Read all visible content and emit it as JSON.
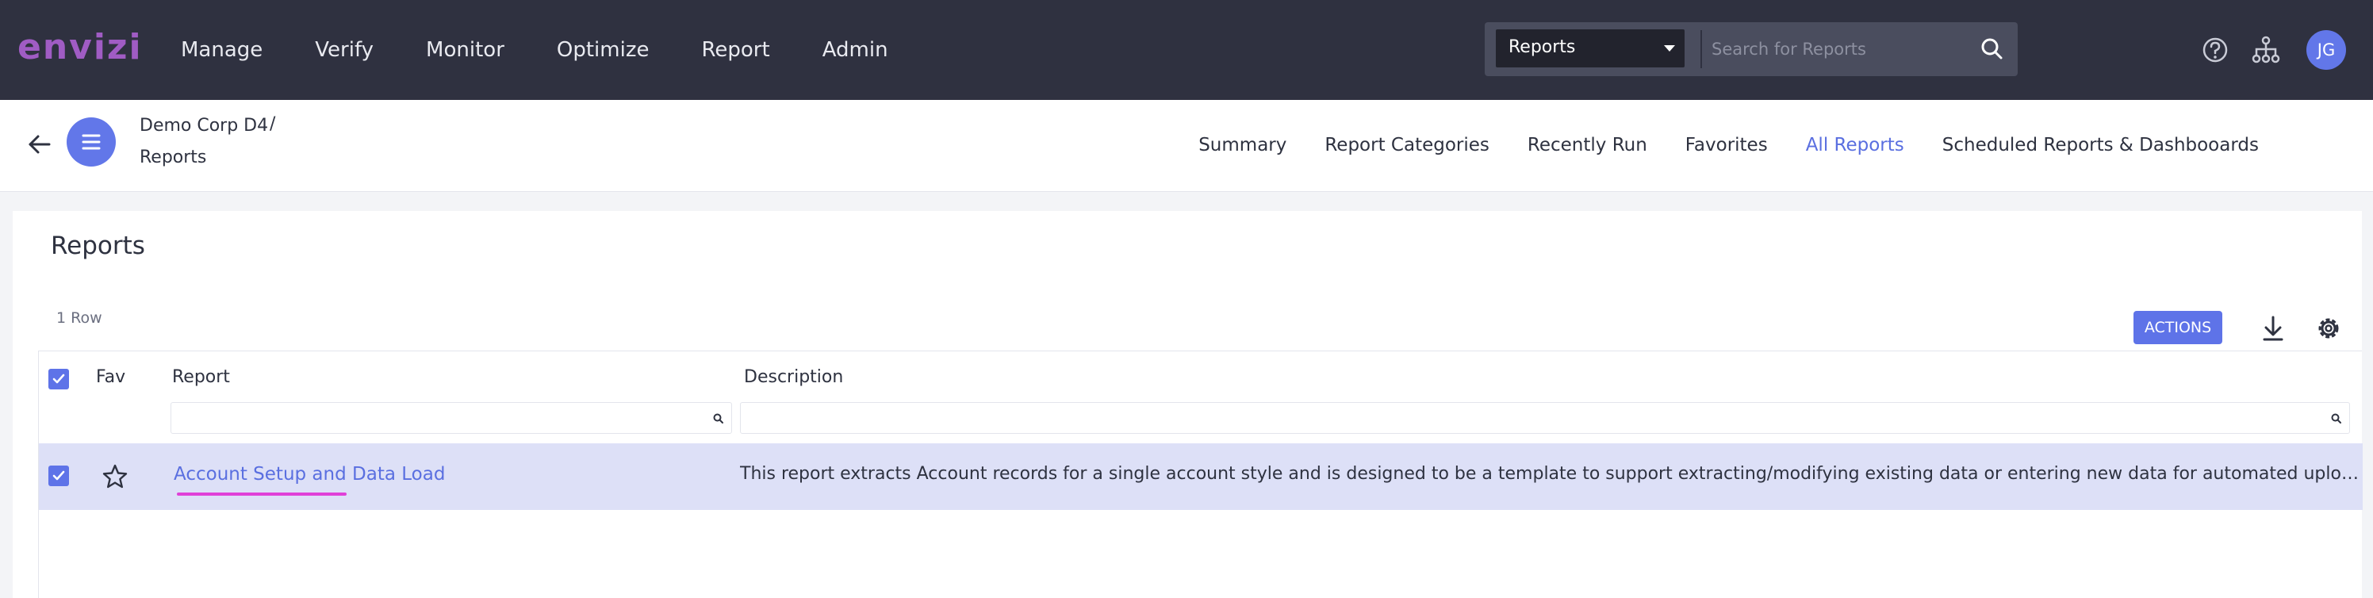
{
  "brand": {
    "logo_text": "envizi",
    "logo_color": "#a05cc4"
  },
  "nav": {
    "items": [
      "Manage",
      "Verify",
      "Monitor",
      "Optimize",
      "Report",
      "Admin"
    ]
  },
  "search": {
    "scope_selected": "Reports",
    "placeholder": "Search for Reports"
  },
  "topbar_icons": [
    "help-icon",
    "hierarchy-icon"
  ],
  "user": {
    "initials": "JG"
  },
  "breadcrumb": {
    "org": "Demo Corp D4",
    "separator": "/",
    "page": "Reports"
  },
  "subnav": {
    "tabs": [
      "Summary",
      "Report Categories",
      "Recently Run",
      "Favorites",
      "All Reports",
      "Scheduled Reports & Dashbooards"
    ],
    "active": "All Reports"
  },
  "main": {
    "title": "Reports",
    "row_count": "1 Row",
    "actions_label": "ACTIONS",
    "columns": {
      "fav": "Fav",
      "report": "Report",
      "description": "Description"
    },
    "rows": [
      {
        "selected": true,
        "favorite": false,
        "report": "Account Setup and Data Load",
        "description": "This report extracts Account records for a single account style and is designed to be a template to support extracting/modifying existing data or entering new data for automated upload into Envizi. Water, Electricity, Gas and other account styles can be selected."
      }
    ]
  },
  "colors": {
    "accent": "#5e73e8",
    "topbar": "#2f3140",
    "selected_row": "#dde0f7",
    "highlight": "#e040d8"
  }
}
